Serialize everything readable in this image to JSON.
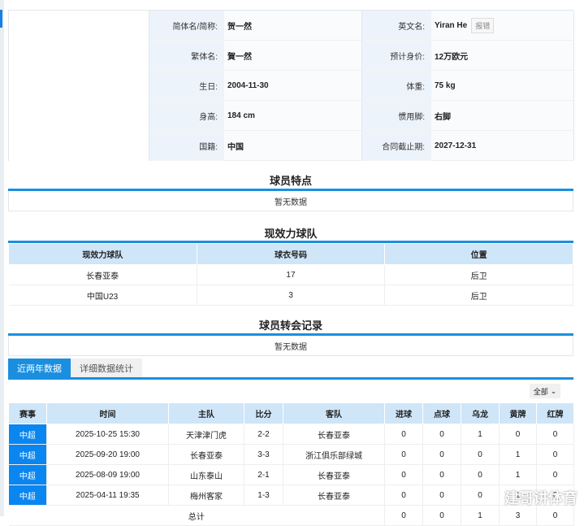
{
  "info": {
    "rows": [
      {
        "l1": "简体名/简称:",
        "v1": "贺一然",
        "l2": "英文名:",
        "v2": "Yiran He"
      },
      {
        "l1": "繁体名:",
        "v1": "賀一然",
        "l2": "预计身价:",
        "v2": "12万欧元"
      },
      {
        "l1": "生日:",
        "v1": "2004-11-30",
        "l2": "体重:",
        "v2": "75 kg"
      },
      {
        "l1": "身高:",
        "v1": "184 cm",
        "l2": "惯用脚:",
        "v2": "右脚"
      },
      {
        "l1": "国籍:",
        "v1": "中国",
        "l2": "合同截止期:",
        "v2": "2027-12-31"
      }
    ],
    "report_error": "报错"
  },
  "traits": {
    "title": "球员特点",
    "empty": "暂无数据"
  },
  "teams": {
    "title": "现效力球队",
    "headers": [
      "现效力球队",
      "球衣号码",
      "位置"
    ],
    "rows": [
      [
        "长春亚泰",
        "17",
        "后卫"
      ],
      [
        "中国U23",
        "3",
        "后卫"
      ]
    ]
  },
  "transfers": {
    "title": "球员转会记录",
    "empty": "暂无数据"
  },
  "tabs": [
    "近两年数据",
    "详细数据统计"
  ],
  "filter": "全部",
  "stats": {
    "headers": [
      "赛事",
      "时间",
      "主队",
      "比分",
      "客队",
      "进球",
      "点球",
      "乌龙",
      "黄牌",
      "红牌"
    ],
    "rows": [
      [
        "中超",
        "2025-10-25 15:30",
        "天津津门虎",
        "2-2",
        "长春亚泰",
        "0",
        "0",
        "1",
        "0",
        "0"
      ],
      [
        "中超",
        "2025-09-20 19:00",
        "长春亚泰",
        "3-3",
        "浙江俱乐部绿城",
        "0",
        "0",
        "0",
        "1",
        "0"
      ],
      [
        "中超",
        "2025-08-09 19:00",
        "山东泰山",
        "2-1",
        "长春亚泰",
        "0",
        "0",
        "0",
        "1",
        "0"
      ],
      [
        "中超",
        "2025-04-11 19:35",
        "梅州客家",
        "1-3",
        "长春亚泰",
        "0",
        "0",
        "0",
        "1",
        "0"
      ]
    ],
    "total": {
      "label": "总计",
      "values": [
        "0",
        "0",
        "1",
        "3",
        "0"
      ]
    }
  },
  "watermark": "建哥讲体育"
}
